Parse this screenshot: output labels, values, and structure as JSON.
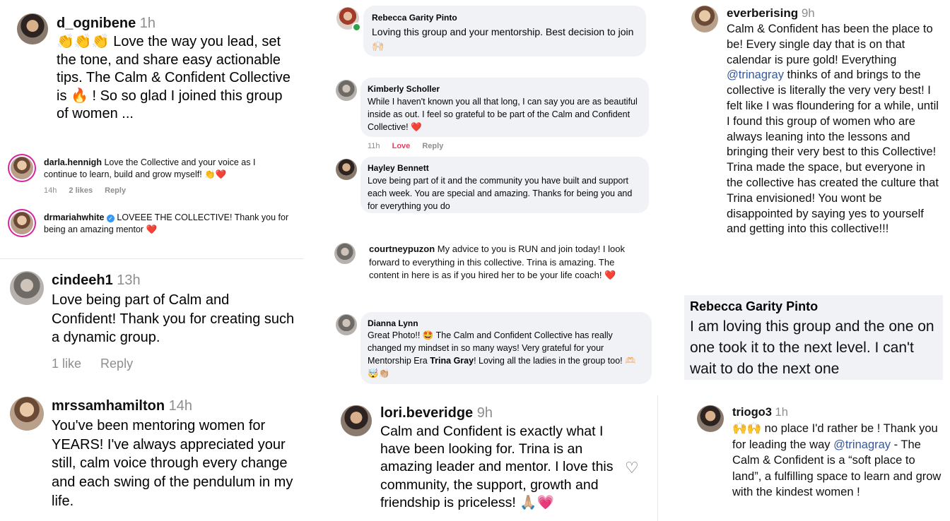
{
  "c1": {
    "user": "d_ognibene",
    "time": "1h",
    "text": "👏👏👏 Love the way you lead, set the tone, and share easy actionable tips. The Calm & Confident Collective is 🔥 ! So so glad I joined this group of women ..."
  },
  "c2": {
    "user": "darla.hennigh",
    "text": "Love the Collective and your voice as I continue to learn, build and grow myself! 👏❤️",
    "time": "14h",
    "likes": "2 likes",
    "reply": "Reply"
  },
  "c3": {
    "user": "drmariahwhite",
    "text": "LOVEEE THE COLLECTIVE! Thank you for being an amazing mentor ❤️"
  },
  "c4": {
    "user": "cindeeh1",
    "time": "13h",
    "text": "Love being part of Calm and Confident! Thank you for creating such a dynamic group.",
    "likes": "1 like",
    "reply": "Reply"
  },
  "c5": {
    "user": "mrssamhamilton",
    "time": "14h",
    "text": "You've been mentoring women for YEARS! I've always appreciated your still, calm voice through every change and each swing of the pendulum in my life."
  },
  "f1": {
    "name": "Rebecca Garity Pinto",
    "text": "Loving this group and your mentorship. Best decision to join 🙌🏻"
  },
  "f2": {
    "name": "Kimberly Scholler",
    "text": "While I haven't known you all that long, I can say you are as beautiful inside as out. I feel so grateful to be part of the Calm and Confident Collective! ❤️",
    "time": "11h",
    "love": "Love",
    "reply": "Reply"
  },
  "f3": {
    "name": "Hayley Bennett",
    "text": "Love being part of it and the community you have built and support each week. You are special and amazing. Thanks for being you and for everything you do"
  },
  "f4": {
    "user": "courtneypuzon",
    "text": "My advice to you is RUN and join today! I look forward to everything in this collective. Trina is amazing. The content in here is as if you hired her to be your life coach! ❤️"
  },
  "f5": {
    "name": "Dianna Lynn",
    "text_a": "Great Photo!! 🤩 The Calm and Confident Collective has really changed my mindset in so many ways! Very grateful for your Mentorship Era ",
    "bold": "Trina Gray",
    "text_b": "! Loving all the ladies in the group too! 🫶🏻🤯👏🏼"
  },
  "f6": {
    "user": "lori.beveridge",
    "time": "9h",
    "text": "Calm and Confident is exactly what I have been looking for. Trina is an amazing leader and mentor. I love this community, the support, growth and friendship is priceless! 🙏🏼💗"
  },
  "r1": {
    "user": "everberising",
    "time": "9h",
    "text_a": "Calm & Confident has been the place to be! Every single day that is on that calendar is pure gold! Everything ",
    "mention": "@trinagray",
    "text_b": " thinks of and brings to the collective is literally the very very best! I felt like I was floundering for a while, until I found this group of women who are always leaning into the lessons and bringing their very best to this Collective! Trina made the space, but everyone in the collective has created the culture that Trina envisioned! You wont be disappointed by saying yes to yourself and getting into this collective!!!"
  },
  "r2": {
    "name": "Rebecca Garity Pinto",
    "text": "I am loving this group and the one on one took it to the next level. I can't wait to do the next one"
  },
  "r3": {
    "user": "triogo3",
    "time": "1h",
    "text_a": "🙌🙌 no place I'd rather be ! Thank you for leading the way ",
    "mention": "@trinagray",
    "text_b": " - The Calm & Confident is a “soft place to land”, a fulfilling space to learn and grow with the kindest women !"
  }
}
